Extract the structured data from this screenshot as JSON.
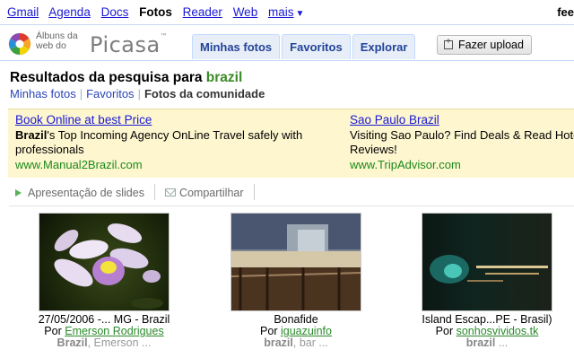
{
  "gbar": {
    "links": [
      {
        "label": "Gmail",
        "active": false
      },
      {
        "label": "Agenda",
        "active": false
      },
      {
        "label": "Docs",
        "active": false
      },
      {
        "label": "Fotos",
        "active": true
      },
      {
        "label": "Reader",
        "active": false
      },
      {
        "label": "Web",
        "active": false
      },
      {
        "label": "mais",
        "active": false
      }
    ],
    "account_fragment": "fee"
  },
  "logo": {
    "small_line1": "Álbuns da",
    "small_line2": "web do",
    "brand": "Picasa"
  },
  "tabs": [
    {
      "label": "Minhas fotos"
    },
    {
      "label": "Favoritos"
    },
    {
      "label": "Explorar"
    }
  ],
  "upload_label": "Fazer upload",
  "results": {
    "prefix": "Resultados da pesquisa para ",
    "query": "brazil"
  },
  "crumbs": {
    "my_photos": "Minhas fotos",
    "favorites": "Favoritos",
    "current": "Fotos da comunidade",
    "separator": "|"
  },
  "ads": [
    {
      "title": "Book Online at best Price",
      "body_bold": "Brazil",
      "body": "'s Top Incoming Agency OnLine Travel safely with professionals",
      "url": "www.Manual2Brazil.com"
    },
    {
      "title": "Sao Paulo Brazil",
      "body_bold": "",
      "body": "Visiting Sao Paulo? Find Deals & Read Hotel Reviews!",
      "url": "www.TripAdvisor.com"
    }
  ],
  "actions": {
    "slideshow": "Apresentação de slides",
    "share": "Compartilhar"
  },
  "photos": [
    {
      "caption": "27/05/2006 -... MG - Brazil",
      "by_prefix": "Por ",
      "author": "Emerson Rodrigues",
      "tag_bold": "Brazil",
      "tag_rest": ", Emerson ..."
    },
    {
      "caption": "Bonafide",
      "by_prefix": "Por ",
      "author": "iguazuinfo",
      "tag_bold": "brazil",
      "tag_rest": ", bar ..."
    },
    {
      "caption": "Island Escap...PE - Brasil)",
      "by_prefix": "Por ",
      "author": "sonhosvividos.tk",
      "tag_bold": "brazil",
      "tag_rest": " ..."
    }
  ],
  "colors": {
    "query_green": "#3a8b26",
    "link_blue": "#1a1ad4",
    "ad_background": "#fdf6cf",
    "ad_url_green": "#1b8a1b",
    "tab_text": "#224499"
  }
}
